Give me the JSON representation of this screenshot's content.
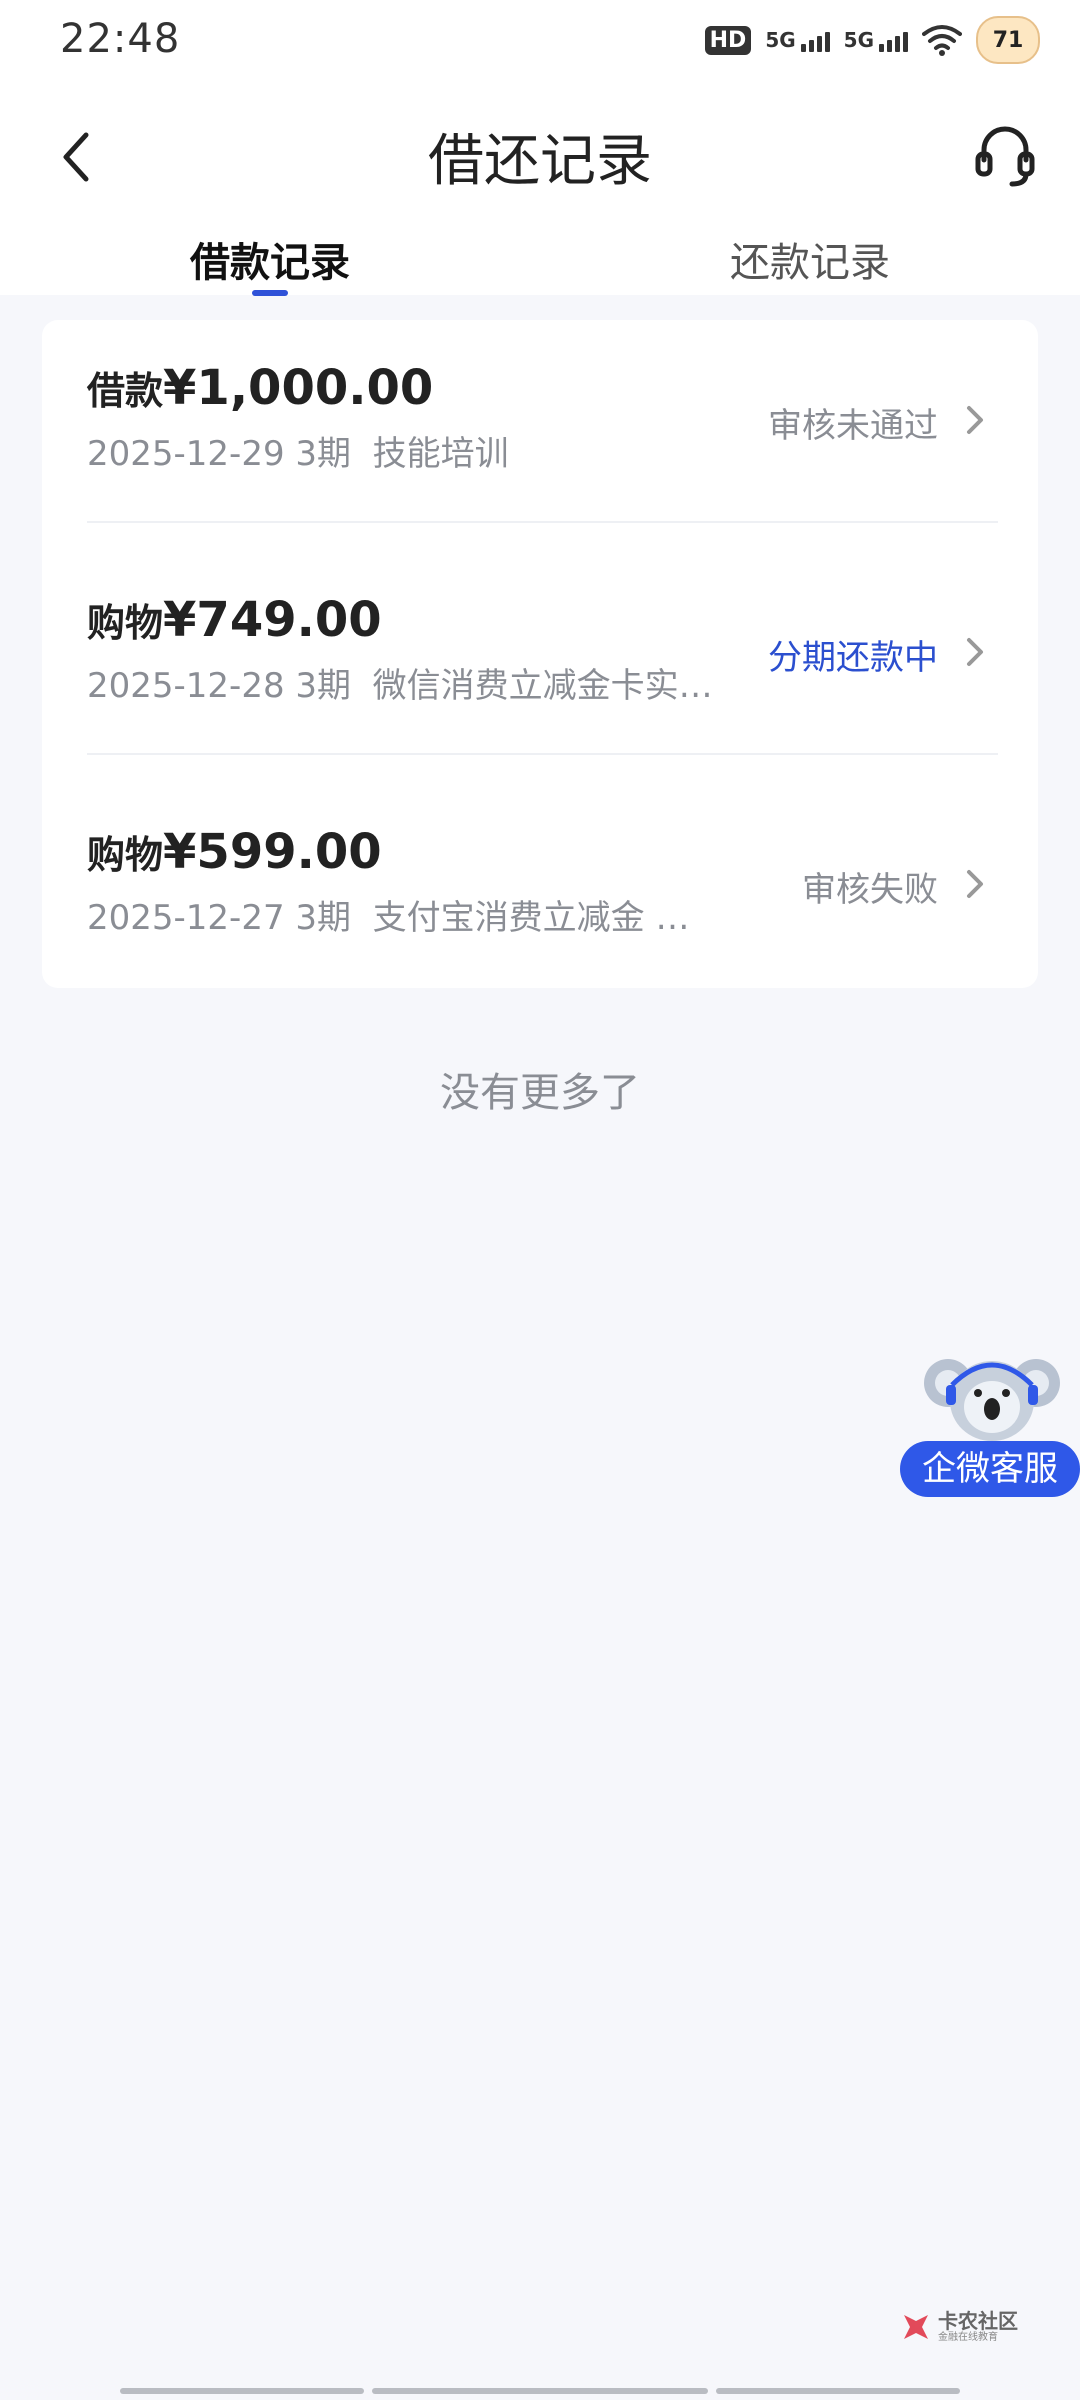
{
  "status_bar": {
    "time": "22:48",
    "hd_label": "HD",
    "network1_label": "5G",
    "network2_label": "5G",
    "battery_level": "71"
  },
  "header": {
    "title": "借还记录",
    "back_icon": "chevron-left-icon",
    "support_icon": "headset-icon"
  },
  "tabs": [
    {
      "label": "借款记录",
      "selected": true
    },
    {
      "label": "还款记录",
      "selected": false
    }
  ],
  "records": [
    {
      "type": "借款",
      "amount": "¥1,000.00",
      "date_terms": "2025-12-29 3期",
      "description": "技能培训",
      "status": "审核未通过",
      "status_active": false
    },
    {
      "type": "购物",
      "amount": "¥749.00",
      "date_terms": "2025-12-28 3期",
      "description": "微信消费立减金卡实…",
      "status": "分期还款中",
      "status_active": true
    },
    {
      "type": "购物",
      "amount": "¥599.00",
      "date_terms": "2025-12-27 3期",
      "description": "支付宝消费立减金 …",
      "status": "审核失败",
      "status_active": false
    }
  ],
  "footer_text": "没有更多了",
  "service_button": {
    "label": "企微客服",
    "icon": "koala-mascot-icon"
  },
  "watermark": {
    "main": "卡农社区",
    "sub": "金融在线教育"
  },
  "colors": {
    "accent": "#2f52d8",
    "status_active": "#2b4fcf",
    "background": "#f6f7fb"
  }
}
